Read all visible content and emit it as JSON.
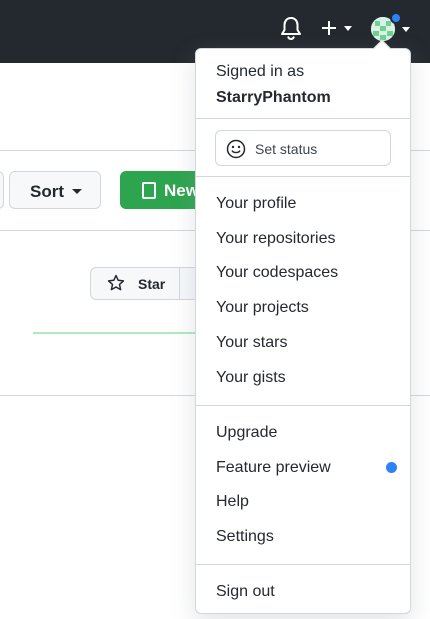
{
  "header": {
    "notifications_icon": "bell-icon",
    "create_icon": "plus-icon",
    "avatar_icon": "identicon-avatar",
    "accent": "#2f81f7"
  },
  "toolbar": {
    "sort_label": "Sort",
    "new_label": "New"
  },
  "repo_card": {
    "star_label": "Star"
  },
  "menu": {
    "signed_in_as": "Signed in as",
    "username": "StarryPhantom",
    "set_status": "Set status",
    "profile_items": [
      "Your profile",
      "Your repositories",
      "Your codespaces",
      "Your projects",
      "Your stars",
      "Your gists"
    ],
    "extra_items": [
      "Upgrade",
      "Feature preview",
      "Help",
      "Settings"
    ],
    "sign_out": "Sign out"
  },
  "colors": {
    "topbar": "#24292f",
    "new_button": "#2da44e",
    "border": "#d0d7de"
  }
}
